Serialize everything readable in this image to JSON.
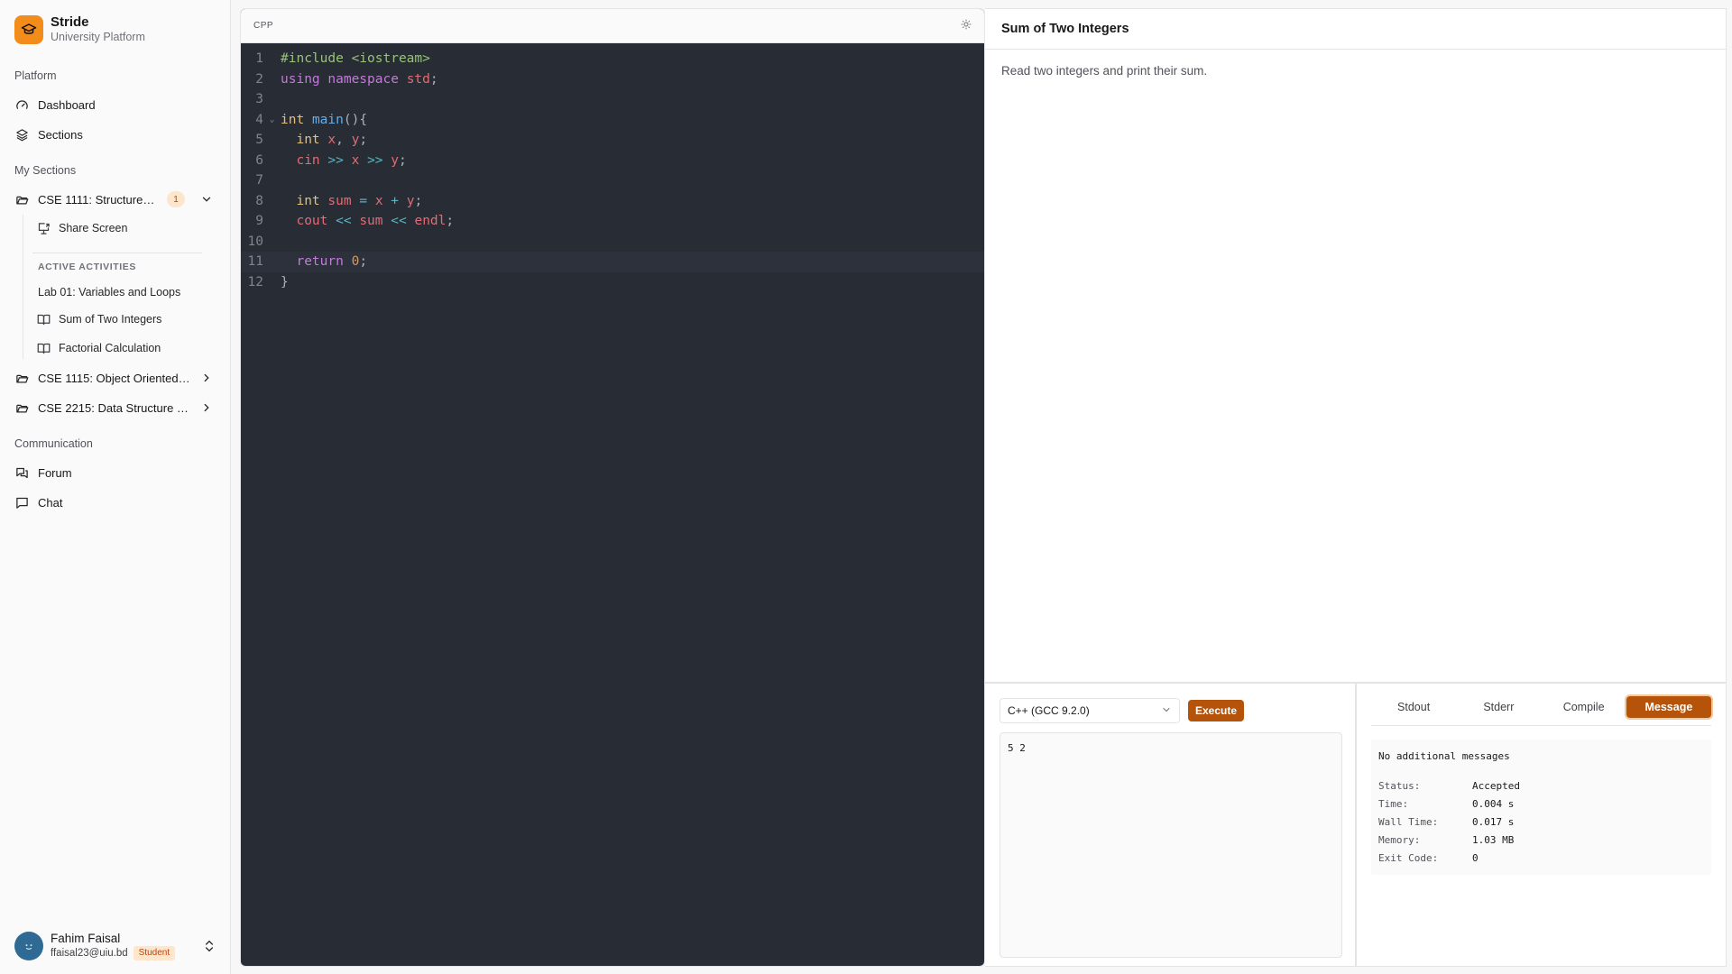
{
  "brand": {
    "name": "Stride",
    "subtitle": "University Platform"
  },
  "sidebar": {
    "platform_label": "Platform",
    "platform_items": [
      {
        "label": "Dashboard",
        "icon": "gauge-icon"
      },
      {
        "label": "Sections",
        "icon": "layers-icon"
      }
    ],
    "my_sections_label": "My Sections",
    "sections": [
      {
        "label": "CSE 1111: Structured Pro...",
        "badge": "1",
        "expanded": true
      },
      {
        "label": "CSE 1115: Object Oriented Pro...",
        "expanded": false
      },
      {
        "label": "CSE 2215: Data Structure and ...",
        "expanded": false
      }
    ],
    "share_screen": "Share Screen",
    "active_activities_label": "ACTIVE ACTIVITIES",
    "activities": [
      "Lab 01: Variables and Loops",
      "Sum of Two Integers",
      "Factorial Calculation"
    ],
    "communication_label": "Communication",
    "communication_items": [
      {
        "label": "Forum",
        "icon": "messages-icon"
      },
      {
        "label": "Chat",
        "icon": "message-square-icon"
      }
    ]
  },
  "user": {
    "name": "Fahim Faisal",
    "email": "ffaisal23@uiu.bd",
    "role": "Student"
  },
  "editor": {
    "language": "CPP",
    "lines": [
      "#include <iostream>",
      "using namespace std;",
      "",
      "int main(){",
      "  int x, y;",
      "  cin >> x >> y;",
      "",
      "  int sum = x + y;",
      "  cout << sum << endl;",
      "",
      "  return 0;",
      "}"
    ],
    "active_line": 11,
    "fold_line": 4
  },
  "problem": {
    "title": "Sum of Two Integers",
    "description": "Read two integers and print their sum."
  },
  "runner": {
    "compiler": "C++ (GCC 9.2.0)",
    "execute_label": "Execute",
    "stdin": "5 2"
  },
  "output": {
    "tabs": [
      "Stdout",
      "Stderr",
      "Compile",
      "Message"
    ],
    "active_tab": "Message",
    "message": "No additional messages",
    "details": [
      {
        "key": "Status:",
        "value": "Accepted"
      },
      {
        "key": "Time:",
        "value": "0.004 s"
      },
      {
        "key": "Wall Time:",
        "value": "0.017 s"
      },
      {
        "key": "Memory:",
        "value": "1.03 MB"
      },
      {
        "key": "Exit Code:",
        "value": "0"
      }
    ]
  },
  "colors": {
    "accent": "#b45309",
    "brand": "#f28c1b",
    "editor_bg": "#282c34"
  }
}
